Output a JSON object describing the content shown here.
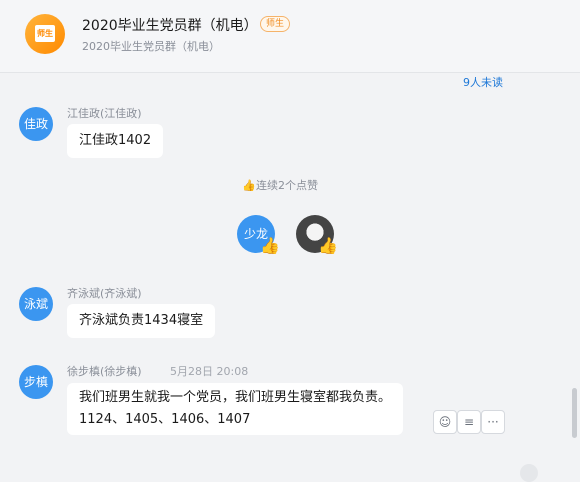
{
  "header": {
    "title": "2020毕业生党员群（机电）",
    "role_tag": "师生",
    "subtitle": "2020毕业生党员群（机电）",
    "avatar_text": "师生"
  },
  "unread_label": "9人未读",
  "messages": [
    {
      "avatar": "佳政",
      "sender": "江佳政(江佳政)",
      "text": "江佳政1402"
    },
    {
      "avatar": "泳斌",
      "sender": "齐泳斌(齐泳斌)",
      "text": "齐泳斌负责1434寝室"
    },
    {
      "avatar": "步槙",
      "sender": "徐步槙(徐步槙)",
      "time": "5月28日 20:08",
      "text_line1": "我们班男生就我一个党员，我们班男生寝室都我负责。",
      "text_line2": "1124、1405、1406、1407"
    }
  ],
  "likes": {
    "label": "连续2个点赞",
    "avatar_a": "少龙",
    "thumb": "👍"
  },
  "tools": {
    "emoji": "☺",
    "quote": "≡",
    "more": "···"
  }
}
